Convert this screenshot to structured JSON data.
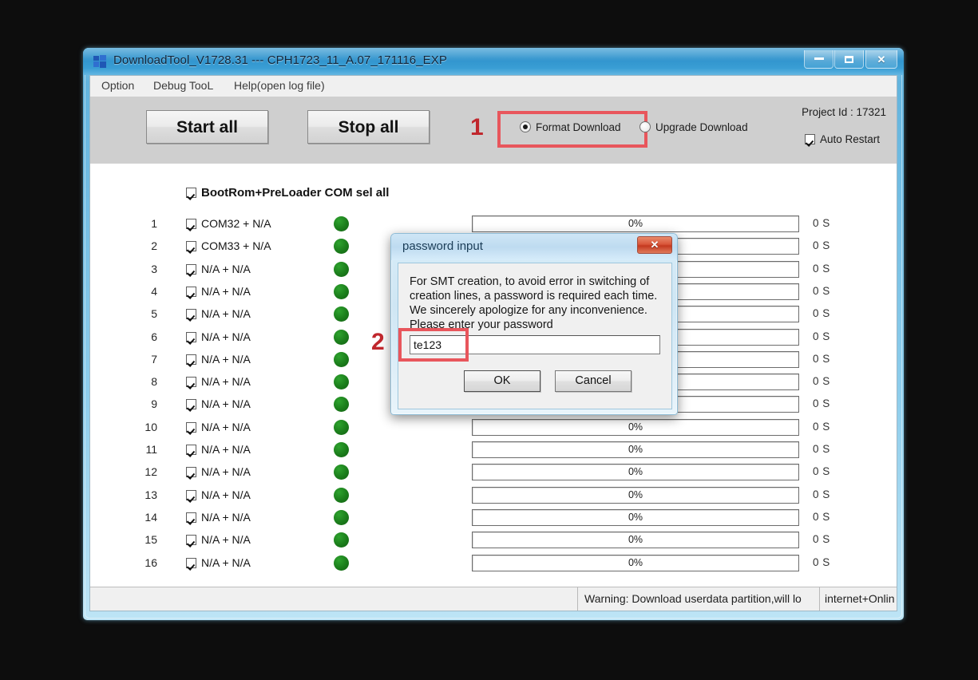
{
  "window": {
    "title": "DownloadTool_V1728.31 --- CPH1723_11_A.07_171116_EXP",
    "icon": "windows-logo-icon",
    "controls": {
      "minimize": "–",
      "maximize": "▭",
      "close": "✕"
    }
  },
  "menubar": {
    "items": [
      {
        "label": "Option"
      },
      {
        "label": "Debug TooL"
      },
      {
        "label": "Help(open log file)"
      }
    ]
  },
  "toolbar": {
    "start_all_label": "Start all",
    "stop_all_label": "Stop all",
    "marker_one": "1",
    "download_modes": [
      {
        "label": "Format Download",
        "selected": true
      },
      {
        "label": "Upgrade Download",
        "selected": false
      }
    ],
    "project_id_label": "Project Id : 17321",
    "auto_restart_label": "Auto Restart",
    "auto_restart_checked": true,
    "highlight_color": "#e8565c",
    "marker_color": "#c0272d"
  },
  "grid": {
    "select_all_label": "BootRom+PreLoader COM sel all",
    "select_all_checked": true,
    "led_color": "#1b7d1b",
    "rows": [
      {
        "index": "1",
        "checked": true,
        "port": "COM32 + N/A",
        "led": "green",
        "progress": "0%",
        "progress_value": 0,
        "time": "0 S"
      },
      {
        "index": "2",
        "checked": true,
        "port": "COM33 + N/A",
        "led": "green",
        "progress": "0%",
        "progress_value": 0,
        "time": "0 S"
      },
      {
        "index": "3",
        "checked": true,
        "port": "N/A + N/A",
        "led": "green",
        "progress": "0%",
        "progress_value": 0,
        "time": "0 S"
      },
      {
        "index": "4",
        "checked": true,
        "port": "N/A + N/A",
        "led": "green",
        "progress": "0%",
        "progress_value": 0,
        "time": "0 S"
      },
      {
        "index": "5",
        "checked": true,
        "port": "N/A + N/A",
        "led": "green",
        "progress": "0%",
        "progress_value": 0,
        "time": "0 S"
      },
      {
        "index": "6",
        "checked": true,
        "port": "N/A + N/A",
        "led": "green",
        "progress": "0%",
        "progress_value": 0,
        "time": "0 S"
      },
      {
        "index": "7",
        "checked": true,
        "port": "N/A + N/A",
        "led": "green",
        "progress": "0%",
        "progress_value": 0,
        "time": "0 S"
      },
      {
        "index": "8",
        "checked": true,
        "port": "N/A + N/A",
        "led": "green",
        "progress": "0%",
        "progress_value": 0,
        "time": "0 S"
      },
      {
        "index": "9",
        "checked": true,
        "port": "N/A + N/A",
        "led": "green",
        "progress": "0%",
        "progress_value": 0,
        "time": "0 S"
      },
      {
        "index": "10",
        "checked": true,
        "port": "N/A + N/A",
        "led": "green",
        "progress": "0%",
        "progress_value": 0,
        "time": "0 S"
      },
      {
        "index": "11",
        "checked": true,
        "port": "N/A + N/A",
        "led": "green",
        "progress": "0%",
        "progress_value": 0,
        "time": "0 S"
      },
      {
        "index": "12",
        "checked": true,
        "port": "N/A + N/A",
        "led": "green",
        "progress": "0%",
        "progress_value": 0,
        "time": "0 S"
      },
      {
        "index": "13",
        "checked": true,
        "port": "N/A + N/A",
        "led": "green",
        "progress": "0%",
        "progress_value": 0,
        "time": "0 S"
      },
      {
        "index": "14",
        "checked": true,
        "port": "N/A + N/A",
        "led": "green",
        "progress": "0%",
        "progress_value": 0,
        "time": "0 S"
      },
      {
        "index": "15",
        "checked": true,
        "port": "N/A + N/A",
        "led": "green",
        "progress": "0%",
        "progress_value": 0,
        "time": "0 S"
      },
      {
        "index": "16",
        "checked": true,
        "port": "N/A + N/A",
        "led": "green",
        "progress": "0%",
        "progress_value": 0,
        "time": "0 S"
      }
    ]
  },
  "statusbar": {
    "warning": "Warning: Download userdata partition,will lo",
    "network": "internet+Onlin"
  },
  "dialog": {
    "title": "password input",
    "close_label": "✕",
    "message": "For SMT creation, to avoid error in switching of creation lines, a password is required each time. We sincerely apologize for any inconvenience. Please enter your password",
    "password_value": "te123",
    "password_placeholder": "",
    "ok_label": "OK",
    "cancel_label": "Cancel",
    "marker_two": "2"
  }
}
